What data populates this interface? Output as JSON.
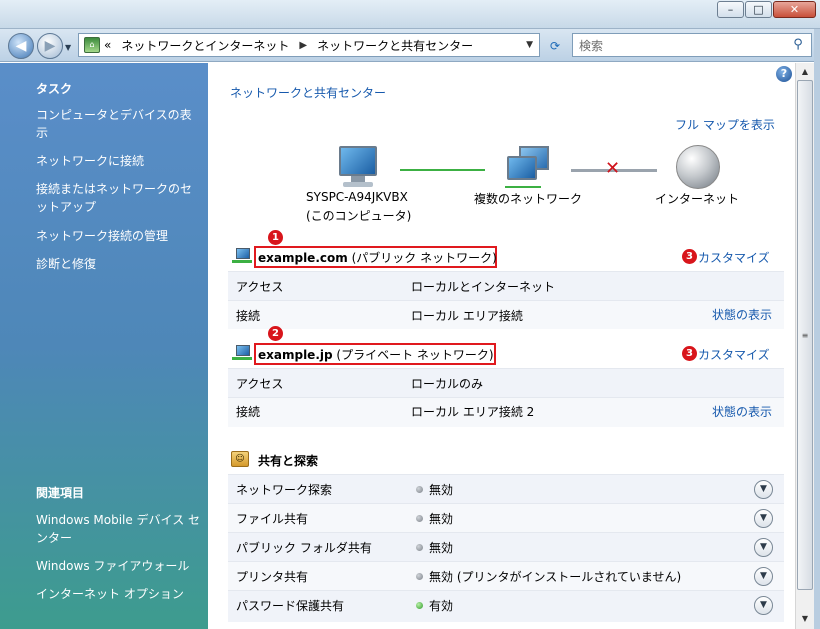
{
  "window": {
    "minimize": "–",
    "maximize": "□",
    "close": "✕"
  },
  "nav": {
    "back_icon": "back-arrow-icon",
    "forward_icon": "forward-arrow-icon",
    "breadcrumb_prefix": "«",
    "breadcrumb": [
      "ネットワークとインターネット",
      "ネットワークと共有センター"
    ],
    "search_placeholder": "検索"
  },
  "sidebar": {
    "task_heading": "タスク",
    "tasks": [
      "コンピュータとデバイスの表示",
      "ネットワークに接続",
      "接続またはネットワークのセットアップ",
      "ネットワーク接続の管理",
      "診断と修復"
    ],
    "related_heading": "関連項目",
    "related": [
      "Windows Mobile デバイス センター",
      "Windows ファイアウォール",
      "インターネット オプション"
    ]
  },
  "main": {
    "title": "ネットワークと共有センター",
    "full_map": "フル マップを表示",
    "map": {
      "computer_name": "SYSPC-A94JKVBX",
      "computer_sub": "(このコンピュータ)",
      "network": "複数のネットワーク",
      "internet": "インターネット"
    },
    "networks": [
      {
        "badge": "1",
        "name": "example.com",
        "type": "(パブリック ネットワーク)",
        "customize_badge": "3",
        "customize": "カスタマイズ",
        "access_label": "アクセス",
        "access_value": "ローカルとインターネット",
        "conn_label": "接続",
        "conn_value": "ローカル エリア接続",
        "status_link": "状態の表示"
      },
      {
        "badge": "2",
        "name": "example.jp",
        "type": "(プライベート ネットワーク)",
        "customize_badge": "3",
        "customize": "カスタマイズ",
        "access_label": "アクセス",
        "access_value": "ローカルのみ",
        "conn_label": "接続",
        "conn_value": "ローカル エリア接続 2",
        "status_link": "状態の表示"
      }
    ],
    "sharing_heading": "共有と探索",
    "sharing": [
      {
        "label": "ネットワーク探索",
        "value": "無効",
        "on": false
      },
      {
        "label": "ファイル共有",
        "value": "無効",
        "on": false
      },
      {
        "label": "パブリック フォルダ共有",
        "value": "無効",
        "on": false
      },
      {
        "label": "プリンタ共有",
        "value": "無効 (プリンタがインストールされていません)",
        "on": false
      },
      {
        "label": "パスワード保護共有",
        "value": "有効",
        "on": true
      }
    ],
    "colors": {
      "link": "#1659ad",
      "badge": "#d8151b",
      "highlight_box": "#e0191e"
    }
  }
}
